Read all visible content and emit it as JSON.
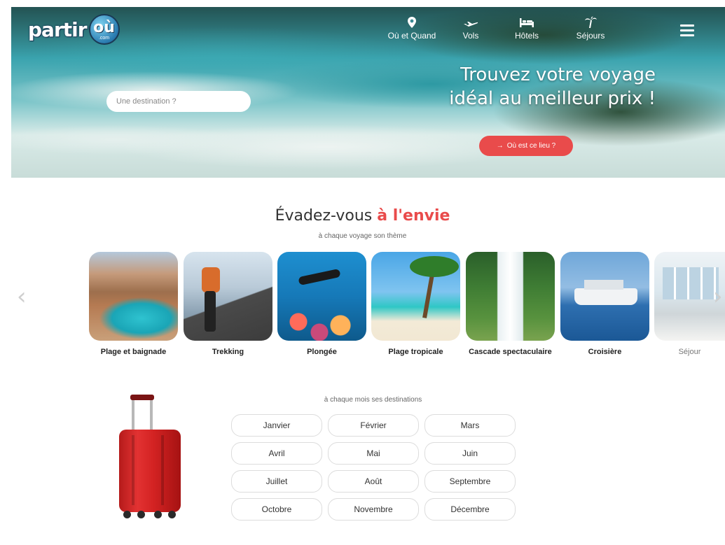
{
  "brand": {
    "logo_text": "partir",
    "logo_globe_text": "où",
    "logo_globe_sub": ".com"
  },
  "nav": {
    "items": [
      {
        "label": "Où et Quand",
        "icon": "map-pin-icon"
      },
      {
        "label": "Vols",
        "icon": "plane-icon"
      },
      {
        "label": "Hôtels",
        "icon": "bed-icon"
      },
      {
        "label": "Séjours",
        "icon": "palm-tree-icon"
      }
    ],
    "menu_icon": "hamburger-menu-icon"
  },
  "hero": {
    "title_line1": "Trouvez votre voyage",
    "title_line2": "idéal au meilleur prix !",
    "search_placeholder": "Une destination ?",
    "cta_label": "Où est ce lieu ?"
  },
  "themes_section": {
    "title_start": "Évadez-vous ",
    "title_accent": "à l'envie",
    "subtitle": "à chaque voyage son thème",
    "items": [
      {
        "label": "Plage et baignade"
      },
      {
        "label": "Trekking"
      },
      {
        "label": "Plongée"
      },
      {
        "label": "Plage tropicale"
      },
      {
        "label": "Cascade spectaculaire"
      },
      {
        "label": "Croisière"
      },
      {
        "label": "Séjour"
      }
    ]
  },
  "months_section": {
    "subtitle": "à chaque mois ses destinations",
    "months": [
      "Janvier",
      "Février",
      "Mars",
      "Avril",
      "Mai",
      "Juin",
      "Juillet",
      "Août",
      "Septembre",
      "Octobre",
      "Novembre",
      "Décembre"
    ]
  },
  "colors": {
    "accent": "#e94b4b",
    "text": "#333333"
  }
}
